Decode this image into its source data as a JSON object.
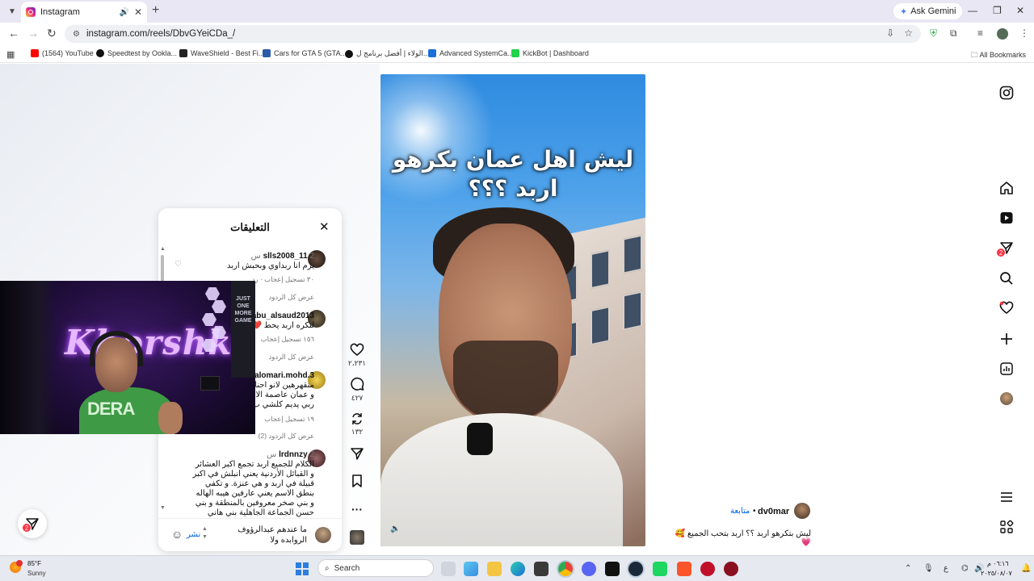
{
  "browser": {
    "tab_title": "Instagram",
    "url": "instagram.com/reels/DbvGYeiCDa_/",
    "gemini_label": "Ask Gemini",
    "bookmarks": [
      "(1564) YouTube",
      "Speedtest by Ookla...",
      "WaveShield - Best Fi...",
      "Cars for GTA 5 (GTA...",
      "الولاء | أفضل برنامج ل...",
      "Advanced SystemCa...",
      "KickBot | Dashboard"
    ],
    "all_bookmarks": "All Bookmarks"
  },
  "video": {
    "title_line1": "ليش اهل عمان بكرهو",
    "title_line2": "اربد ؟؟؟"
  },
  "actions": {
    "likes": "٢،٢٣١",
    "comments": "٤٢٧",
    "reposts": "١٣٢"
  },
  "caption": {
    "username": "dv0mar",
    "follow": "متابعة",
    "text": "ليش بتكرهو اربد ؟؟ اربد بتحب الجميع 🥰💗"
  },
  "comments_panel": {
    "title": "التعليقات",
    "items": [
      {
        "user": "slls2008_11",
        "time": "2 س",
        "body": "يزم انا ربداوي وبحبش اربد",
        "meta": "٣٠ تسجيل إعجاب · رد",
        "replies": "عرض كل الردود"
      },
      {
        "user": "abu_alsaud2013",
        "time": "",
        "body": "لنكره اربد يحط ❤️",
        "meta": "١٥٦ تسجيل إعجاب",
        "replies": "عرض كل الردود"
      },
      {
        "user": "alomari.mohd.3",
        "time": "",
        "body": "منقهرهين لانو احنا\nو عمان عاصمة الا\nربي يديم كلشي ب",
        "meta": "١٩ تسجيل إعجاب",
        "replies": "عرض كل الردود (2)"
      },
      {
        "user": "lrdnnzy",
        "time": "2 س",
        "body": "الكلام للجميع اربد تجمع اكبر العشائر\nو القبائل الأردنية يعني انبلش في اكبر\nقبيلة في اربد و هي عنزة. و تكفي\nبنطق الاسم يعني عارفين هيبه الهاله\nو بني صخر معروفين بالمنطقة و بني\nحسن الجماعة الجاهلية بني هاني",
        "meta": "",
        "replies": ""
      }
    ],
    "input_text": "ما عندهم عبدالرؤوف\nالروابده ولا",
    "post_label": "نشر"
  },
  "webcam": {
    "neon_text": "Khorshka",
    "poster_text": "JUST ONE MORE GAME",
    "shirt_text": "DERA"
  },
  "rail": {
    "messages_badge": "2"
  },
  "share_badge": "2",
  "taskbar": {
    "temp": "85°F",
    "weather": "Sunny",
    "search_placeholder": "Search",
    "time": "٠٦:١٦ م",
    "date": "٢٠٢٥/٠٨/٠٧",
    "lang": "ع"
  }
}
